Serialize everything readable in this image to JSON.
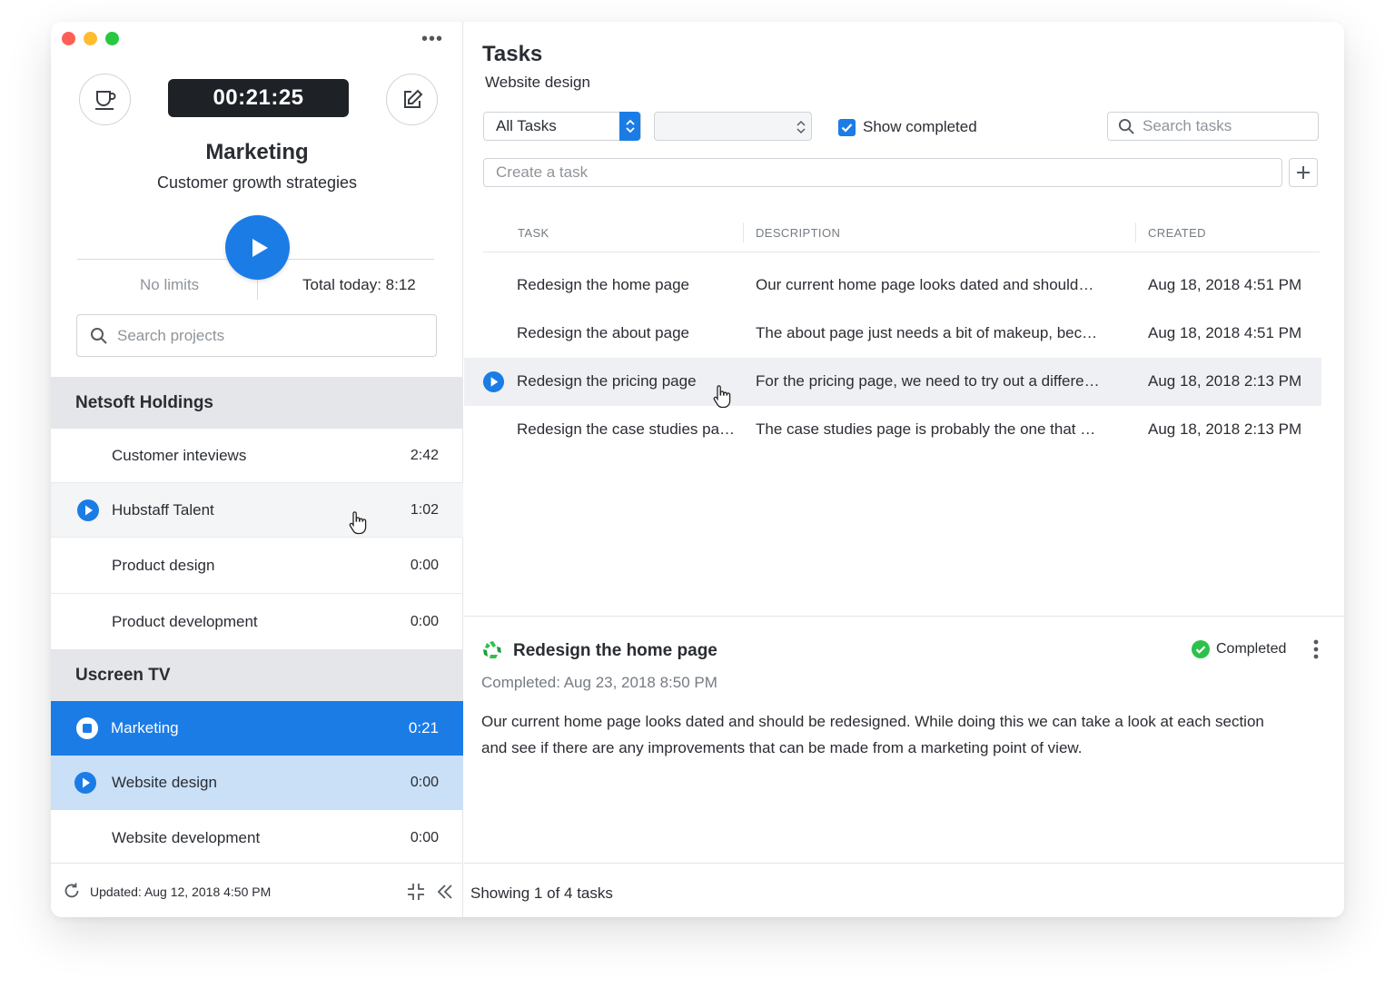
{
  "timer": {
    "value": "00:21:25"
  },
  "current_project": {
    "title": "Marketing",
    "subtitle": "Customer growth strategies"
  },
  "limits": {
    "no_limits": "No limits",
    "total_today": "Total today: 8:12"
  },
  "search_projects": {
    "placeholder": "Search projects"
  },
  "groups": [
    {
      "name": "Netsoft Holdings",
      "projects": [
        {
          "name": "Customer inteviews",
          "time": "2:42"
        },
        {
          "name": "Hubstaff Talent",
          "time": "1:02"
        },
        {
          "name": "Product design",
          "time": "0:00"
        },
        {
          "name": "Product development",
          "time": "0:00"
        }
      ]
    },
    {
      "name": "Uscreen TV",
      "projects": [
        {
          "name": "Marketing",
          "time": "0:21"
        },
        {
          "name": "Website design",
          "time": "0:00"
        },
        {
          "name": "Website development",
          "time": "0:00"
        }
      ]
    }
  ],
  "left_footer": {
    "updated": "Updated: Aug 12, 2018 4:50 PM"
  },
  "tasks_header": {
    "title": "Tasks",
    "subtitle": "Website design"
  },
  "filters": {
    "task_filter": "All Tasks",
    "second_filter": "",
    "show_completed_label": "Show completed",
    "show_completed_checked": true,
    "search_placeholder": "Search tasks"
  },
  "create_task": {
    "placeholder": "Create a task"
  },
  "table": {
    "columns": [
      "TASK",
      "DESCRIPTION",
      "CREATED"
    ],
    "rows": [
      {
        "task": "Redesign the home page",
        "description": "Our current home page looks dated and should…",
        "created": "Aug 18, 2018 4:51 PM"
      },
      {
        "task": "Redesign the about page",
        "description": "The about page just needs a bit of makeup, bec…",
        "created": "Aug 18, 2018 4:51 PM"
      },
      {
        "task": "Redesign the pricing page",
        "description": "For the pricing page, we need to try out a differe…",
        "created": "Aug 18, 2018 2:13 PM"
      },
      {
        "task": "Redesign the case studies pa…",
        "description": "The case studies page is probably the one that …",
        "created": "Aug 18, 2018 2:13 PM"
      }
    ]
  },
  "detail": {
    "title": "Redesign the home page",
    "status": "Completed",
    "completed_date": "Completed: Aug 23, 2018 8:50 PM",
    "description": "Our current home page looks dated and should be redesigned. While doing this we can take a look at each section and see if there are any improvements that can be made from a marketing point of view."
  },
  "right_footer": {
    "showing": "Showing 1 of 4 tasks"
  },
  "colors": {
    "accent": "#1b7ce6",
    "timer_bg": "#1e2126",
    "selected_row": "#c9e0f7",
    "success": "#2cc14b"
  }
}
